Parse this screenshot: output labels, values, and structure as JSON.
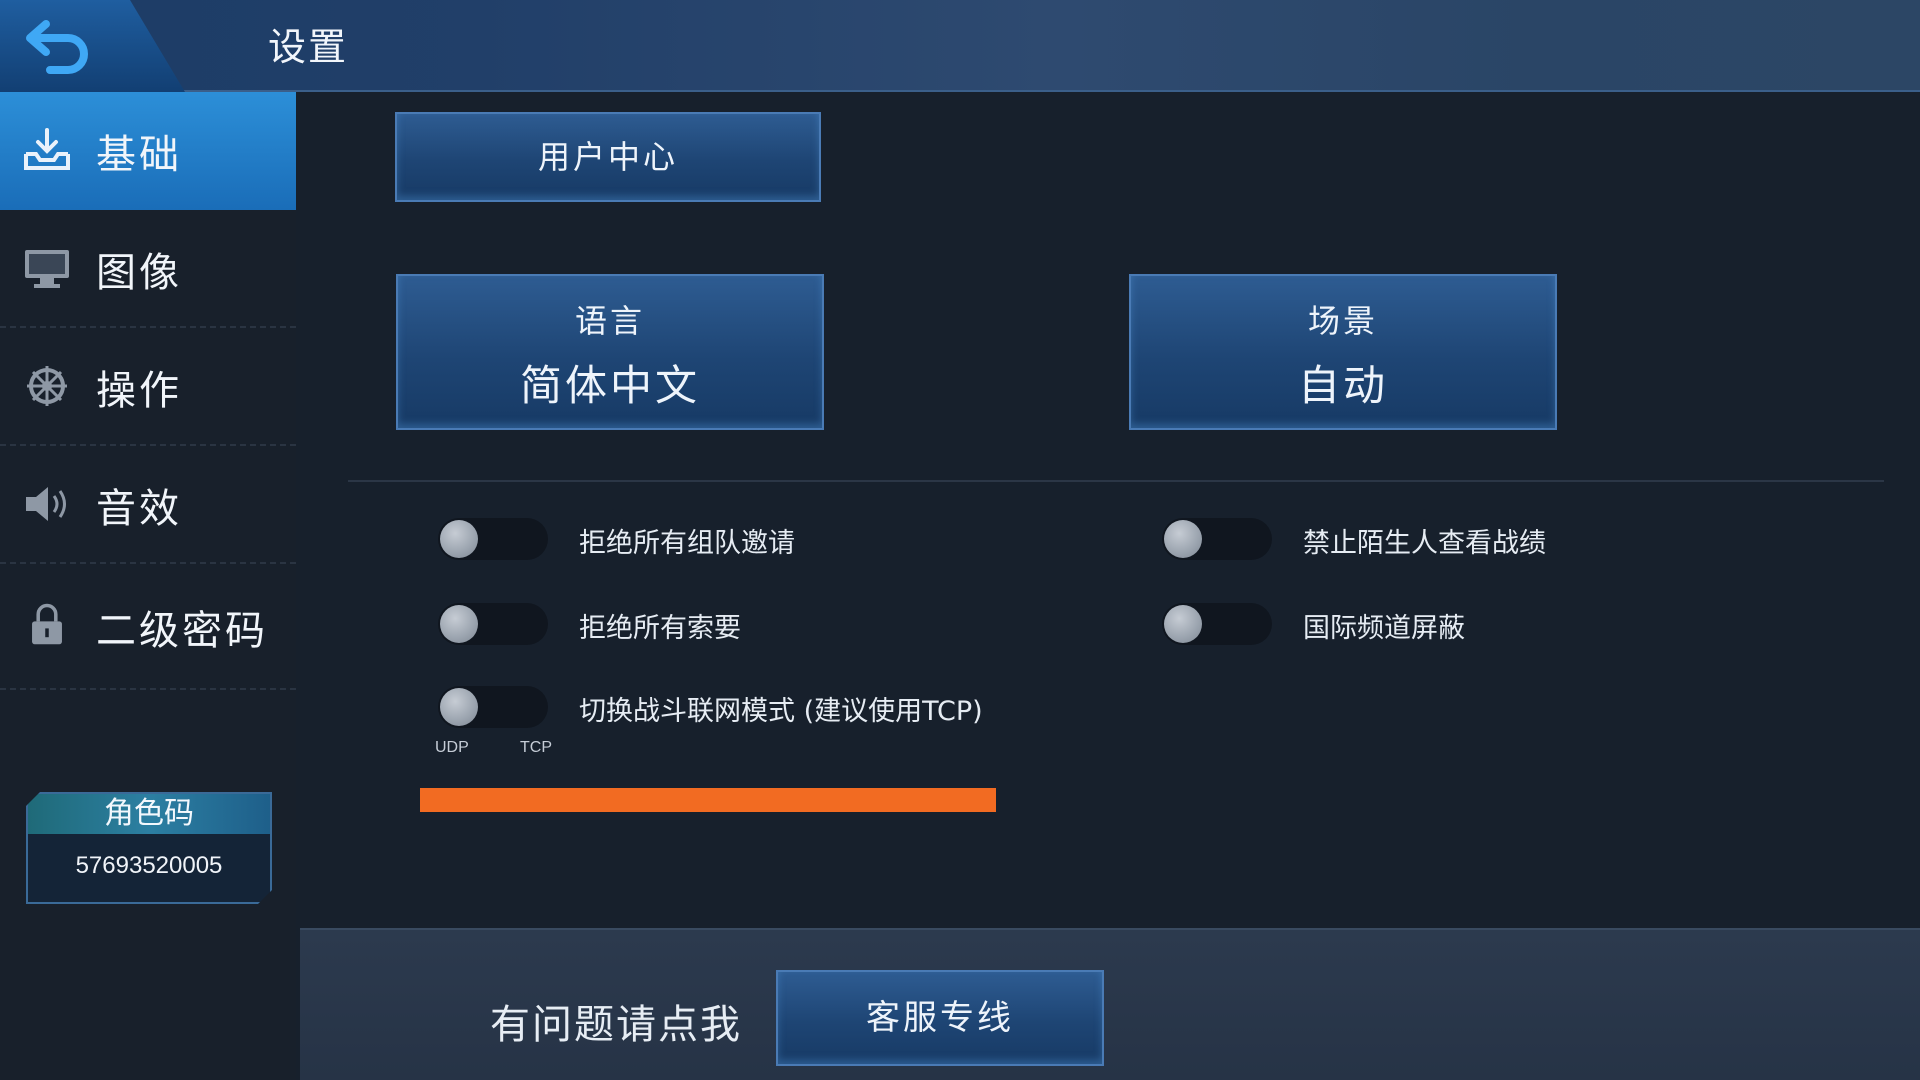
{
  "header": {
    "title": "设置",
    "back_icon": "back-arrow-icon"
  },
  "sidebar": {
    "items": [
      {
        "label": "基础",
        "icon": "download-tray-icon",
        "active": true
      },
      {
        "label": "图像",
        "icon": "monitor-icon",
        "active": false
      },
      {
        "label": "操作",
        "icon": "steering-wheel-icon",
        "active": false
      },
      {
        "label": "音效",
        "icon": "speaker-icon",
        "active": false
      },
      {
        "label": "二级密码",
        "icon": "lock-icon",
        "active": false
      }
    ],
    "role_code": {
      "title": "角色码",
      "value": "57693520005"
    }
  },
  "main": {
    "user_center": "用户中心",
    "language": {
      "label": "语言",
      "value": "简体中文"
    },
    "scene": {
      "label": "场景",
      "value": "自动"
    },
    "toggles": [
      {
        "label": "拒绝所有组队邀请",
        "on": false
      },
      {
        "label": "禁止陌生人查看战绩",
        "on": false
      },
      {
        "label": "拒绝所有索要",
        "on": false
      },
      {
        "label": "国际频道屏蔽",
        "on": false
      },
      {
        "label": "切换战斗联网模式 (建议使用TCP)",
        "on": false
      }
    ],
    "network_mode": {
      "left": "UDP",
      "right": "TCP"
    }
  },
  "footer": {
    "help_text": "有问题请点我",
    "service_button": "客服专线"
  },
  "colors": {
    "accent_blue": "#1a6db8",
    "button_blue": "#1e4574",
    "highlight_orange": "#f26b22",
    "background": "#17202c"
  }
}
